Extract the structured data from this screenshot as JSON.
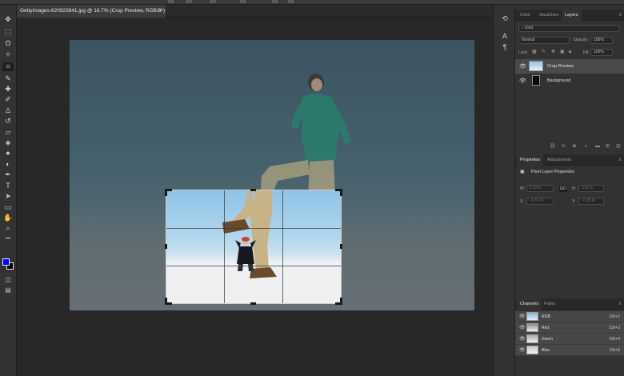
{
  "document": {
    "tab_title": "GettyImages-620923641.jpg @ 16.7% (Crop Preview, RGB/8*)",
    "close_glyph": "×"
  },
  "tools": [
    {
      "icon": "move-tool-icon",
      "glyph": "✥"
    },
    {
      "icon": "marquee-tool-icon",
      "glyph": "⬚"
    },
    {
      "icon": "lasso-tool-icon",
      "glyph": "ʘ"
    },
    {
      "icon": "magic-wand-tool-icon",
      "glyph": "✧"
    },
    {
      "icon": "crop-tool-icon",
      "glyph": "⌗"
    },
    {
      "icon": "eyedropper-tool-icon",
      "glyph": "✎"
    },
    {
      "icon": "healing-brush-tool-icon",
      "glyph": "✚"
    },
    {
      "icon": "brush-tool-icon",
      "glyph": "✐"
    },
    {
      "icon": "clone-stamp-tool-icon",
      "glyph": "♙"
    },
    {
      "icon": "history-brush-tool-icon",
      "glyph": "↺"
    },
    {
      "icon": "eraser-tool-icon",
      "glyph": "▱"
    },
    {
      "icon": "paint-bucket-tool-icon",
      "glyph": "◈"
    },
    {
      "icon": "blur-tool-icon",
      "glyph": "●"
    },
    {
      "icon": "dodge-tool-icon",
      "glyph": "◐"
    },
    {
      "icon": "pen-tool-icon",
      "glyph": "✒"
    },
    {
      "icon": "type-tool-icon",
      "glyph": "T"
    },
    {
      "icon": "path-selection-tool-icon",
      "glyph": "➤"
    },
    {
      "icon": "rectangle-tool-icon",
      "glyph": "▭"
    },
    {
      "icon": "hand-tool-icon",
      "glyph": "✋"
    },
    {
      "icon": "zoom-tool-icon",
      "glyph": "⌕"
    },
    {
      "icon": "more-tools-icon",
      "glyph": "•••"
    }
  ],
  "colors": {
    "foreground": "#0000ff",
    "background": "#000000",
    "accent_crop_border": "#d0d0d0"
  },
  "layers_panel": {
    "tabs": [
      "Color",
      "Swatches",
      "Layers"
    ],
    "active_tab": "Layers",
    "search_placeholder": "Kind",
    "blend_mode": "Normal",
    "opacity_label": "Opacity:",
    "opacity_value": "100%",
    "lock_label": "Lock:",
    "fill_label": "Fill:",
    "fill_value": "100%",
    "layers": [
      {
        "name": "Crop Preview",
        "selected": true
      },
      {
        "name": "Background",
        "selected": false
      }
    ]
  },
  "properties_panel": {
    "tabs": [
      "Properties",
      "Adjustments"
    ],
    "active_tab": "Properties",
    "title": "Pixel Layer Properties",
    "w_label": "W:",
    "w_value": "5.33 in",
    "link_label": "GO",
    "h_label": "H:",
    "h_value": "3.52 in",
    "x_label": "X:",
    "x_value": "-0.74 in",
    "y_label": "Y:",
    "y_value": "-0.05 in"
  },
  "channels_panel": {
    "tabs": [
      "Channels",
      "Paths"
    ],
    "active_tab": "Channels",
    "channels": [
      {
        "name": "RGB",
        "shortcut": "Ctrl+2"
      },
      {
        "name": "Red",
        "shortcut": "Ctrl+3"
      },
      {
        "name": "Green",
        "shortcut": "Ctrl+4"
      },
      {
        "name": "Blue",
        "shortcut": "Ctrl+5"
      }
    ]
  }
}
